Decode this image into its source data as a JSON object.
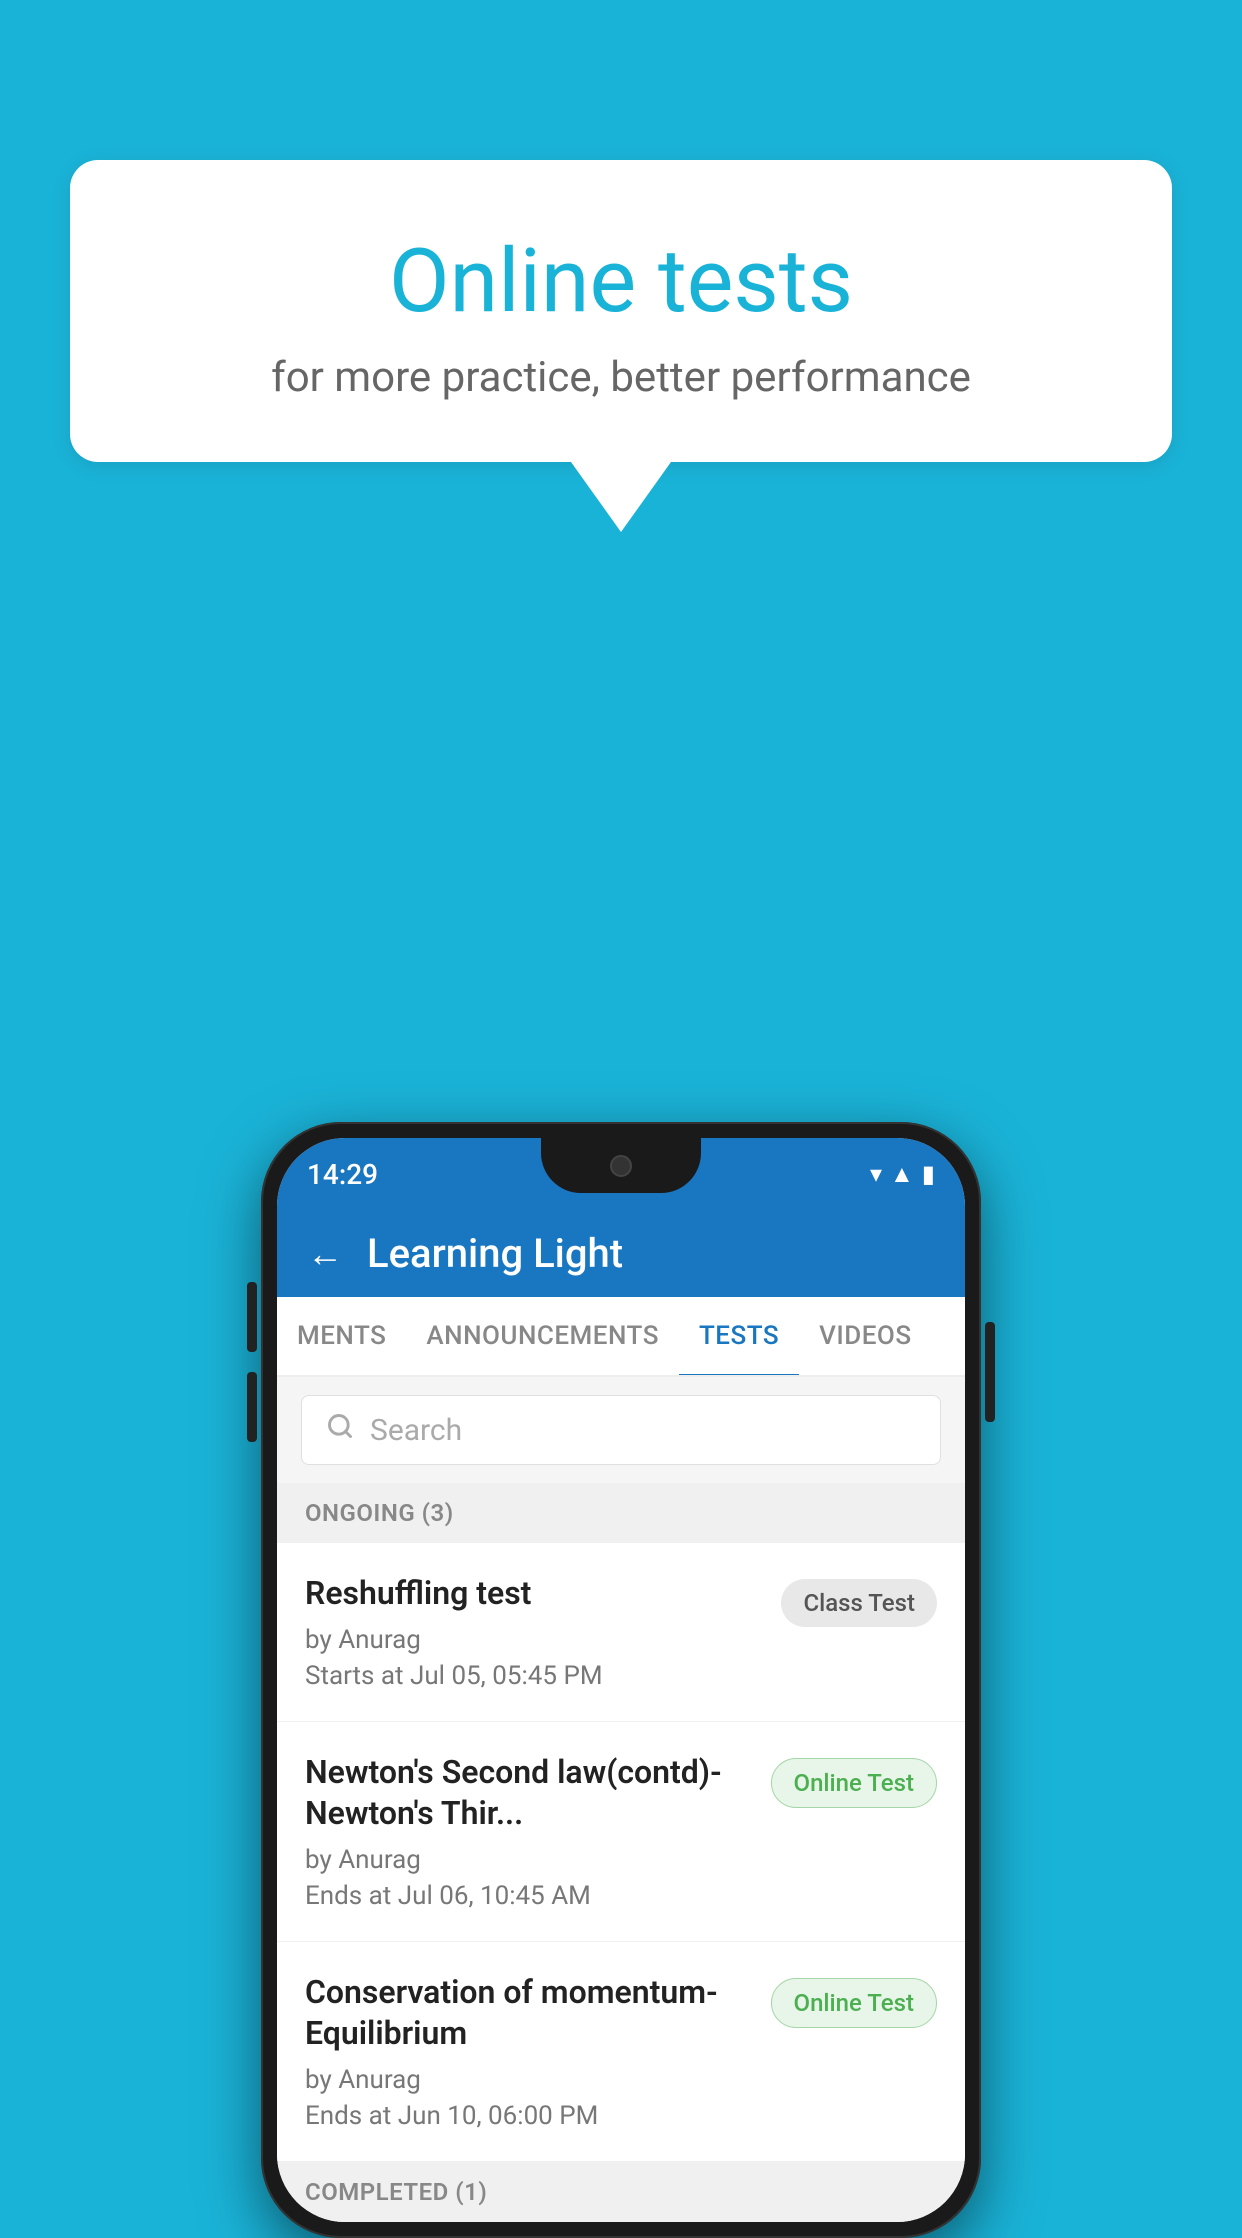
{
  "background_color": "#1ab3d8",
  "speech_bubble": {
    "title": "Online tests",
    "subtitle": "for more practice, better performance"
  },
  "phone": {
    "time": "14:29",
    "app_title": "Learning Light",
    "back_label": "←",
    "tabs": [
      {
        "label": "MENTS",
        "active": false
      },
      {
        "label": "ANNOUNCEMENTS",
        "active": false
      },
      {
        "label": "TESTS",
        "active": true
      },
      {
        "label": "VIDEOS",
        "active": false
      }
    ],
    "search": {
      "placeholder": "Search"
    },
    "ongoing_section": "ONGOING (3)",
    "tests": [
      {
        "name": "Reshuffling test",
        "author": "by Anurag",
        "date": "Starts at  Jul 05, 05:45 PM",
        "badge": "Class Test",
        "badge_type": "class"
      },
      {
        "name": "Newton's Second law(contd)-Newton's Thir...",
        "author": "by Anurag",
        "date": "Ends at  Jul 06, 10:45 AM",
        "badge": "Online Test",
        "badge_type": "online"
      },
      {
        "name": "Conservation of momentum-Equilibrium",
        "author": "by Anurag",
        "date": "Ends at  Jun 10, 06:00 PM",
        "badge": "Online Test",
        "badge_type": "online"
      }
    ],
    "completed_section": "COMPLETED (1)"
  }
}
